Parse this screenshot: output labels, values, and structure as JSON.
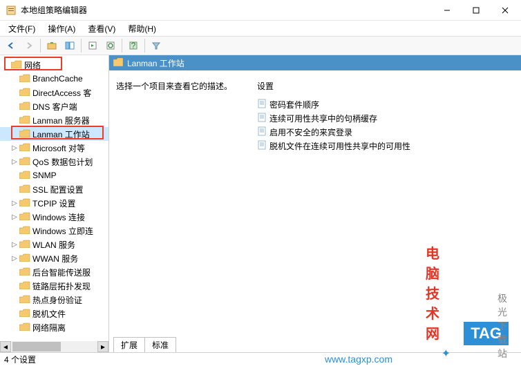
{
  "titlebar": {
    "title": "本地组策略编辑器"
  },
  "menubar": {
    "file": "文件(F)",
    "action": "操作(A)",
    "view": "查看(V)",
    "help": "帮助(H)"
  },
  "tree": {
    "root": "网络",
    "items": [
      {
        "label": "BranchCache",
        "expandable": false
      },
      {
        "label": "DirectAccess 客",
        "expandable": false
      },
      {
        "label": "DNS 客户端",
        "expandable": false
      },
      {
        "label": "Lanman 服务器",
        "expandable": false
      },
      {
        "label": "Lanman 工作站",
        "expandable": false,
        "selected": true
      },
      {
        "label": "Microsoft 对等",
        "expandable": true
      },
      {
        "label": "QoS 数据包计划",
        "expandable": true
      },
      {
        "label": "SNMP",
        "expandable": false
      },
      {
        "label": "SSL 配置设置",
        "expandable": false
      },
      {
        "label": "TCPIP 设置",
        "expandable": true
      },
      {
        "label": "Windows 连接",
        "expandable": true
      },
      {
        "label": "Windows 立即连",
        "expandable": false
      },
      {
        "label": "WLAN 服务",
        "expandable": true
      },
      {
        "label": "WWAN 服务",
        "expandable": true
      },
      {
        "label": "后台智能传送服",
        "expandable": false
      },
      {
        "label": "链路层拓扑发现",
        "expandable": false
      },
      {
        "label": "热点身份验证",
        "expandable": false
      },
      {
        "label": "脱机文件",
        "expandable": false
      },
      {
        "label": "网络隔离",
        "expandable": false
      }
    ]
  },
  "main": {
    "header": "Lanman 工作站",
    "description": "选择一个项目来查看它的描述。",
    "settings_label": "设置",
    "settings": [
      "密码套件顺序",
      "连续可用性共享中的句柄缓存",
      "启用不安全的来宾登录",
      "脱机文件在连续可用性共享中的可用性"
    ]
  },
  "tabs": {
    "extended": "扩展",
    "standard": "标准"
  },
  "statusbar": {
    "text": "4 个设置"
  },
  "watermark": {
    "text1": "电脑技术网",
    "tag": "TAG",
    "url": "www.tagxp.com",
    "jg": "极光下载站"
  }
}
